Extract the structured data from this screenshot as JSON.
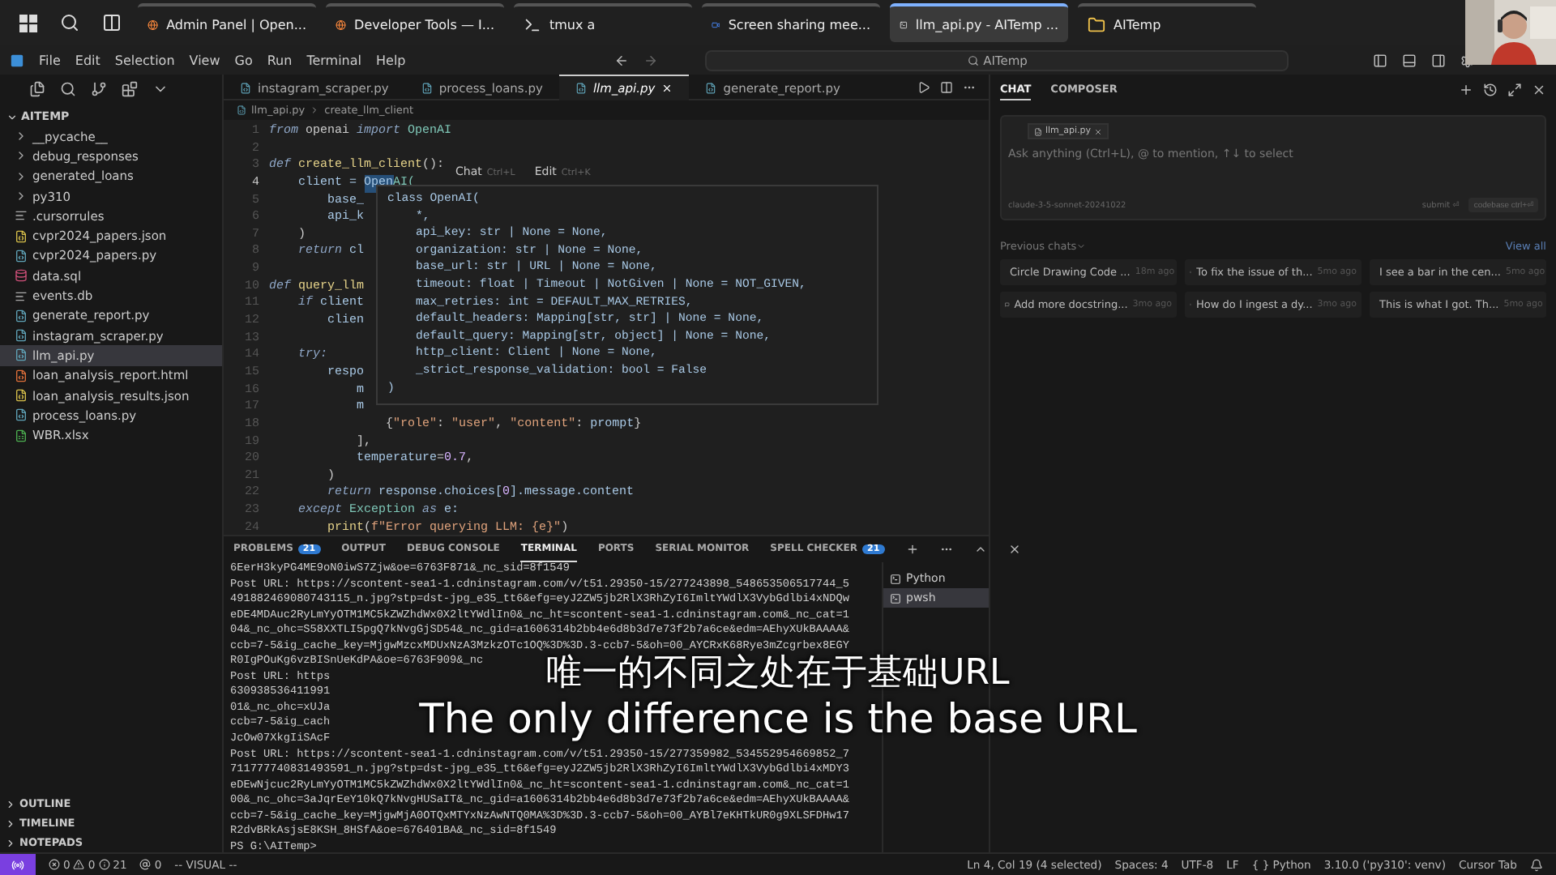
{
  "taskbar": {
    "apps": [
      {
        "label": "Admin Panel | Open...",
        "selected": false
      },
      {
        "label": "Developer Tools — I...",
        "selected": false
      },
      {
        "label": "tmux a",
        "selected": false
      },
      {
        "label": "Screen sharing mee...",
        "selected": false
      },
      {
        "label": "llm_api.py - AITemp ...",
        "selected": true
      },
      {
        "label": "AITemp",
        "selected": false
      }
    ]
  },
  "webcam": {
    "kind": "picture"
  },
  "menu": [
    "File",
    "Edit",
    "Selection",
    "View",
    "Go",
    "Run",
    "Terminal",
    "Help"
  ],
  "command_center": {
    "value": "AITemp"
  },
  "explorer": {
    "title": "AITEMP",
    "items": [
      {
        "name": "__pycache__",
        "kind": "folder",
        "selected": false
      },
      {
        "name": "debug_responses",
        "kind": "folder",
        "selected": false
      },
      {
        "name": "generated_loans",
        "kind": "folder",
        "selected": false
      },
      {
        "name": "py310",
        "kind": "folder",
        "selected": false
      },
      {
        "name": ".cursorrules",
        "kind": "text",
        "selected": false
      },
      {
        "name": "cvpr2024_papers.json",
        "kind": "json",
        "selected": false
      },
      {
        "name": "cvpr2024_papers.py",
        "kind": "py",
        "selected": false
      },
      {
        "name": "data.sql",
        "kind": "sql",
        "selected": false
      },
      {
        "name": "events.db",
        "kind": "text",
        "selected": false
      },
      {
        "name": "generate_report.py",
        "kind": "py",
        "selected": false
      },
      {
        "name": "instagram_scraper.py",
        "kind": "py",
        "selected": false
      },
      {
        "name": "llm_api.py",
        "kind": "py",
        "selected": true
      },
      {
        "name": "loan_analysis_report.html",
        "kind": "html",
        "selected": false
      },
      {
        "name": "loan_analysis_results.json",
        "kind": "json",
        "selected": false
      },
      {
        "name": "process_loans.py",
        "kind": "py",
        "selected": false
      },
      {
        "name": "WBR.xlsx",
        "kind": "xlsx",
        "selected": false
      }
    ],
    "sections": [
      "OUTLINE",
      "TIMELINE",
      "NOTEPADS"
    ]
  },
  "editor_tabs": [
    {
      "label": "instagram_scraper.py",
      "selected": false
    },
    {
      "label": "process_loans.py",
      "selected": false
    },
    {
      "label": "llm_api.py",
      "selected": true
    },
    {
      "label": "generate_report.py",
      "selected": false
    }
  ],
  "breadcrumb": [
    "llm_api.py",
    "create_llm_client"
  ],
  "inline_hint": [
    {
      "label": "Chat",
      "key": "Ctrl+L"
    },
    {
      "label": "Edit",
      "key": "Ctrl+K"
    }
  ],
  "code": [
    {
      "n": "1",
      "tokens": [
        {
          "t": "from",
          "kind": "kw"
        },
        {
          "t": " openai ",
          "kind": "plain"
        },
        {
          "t": "import",
          "kind": "kw"
        },
        {
          "t": " OpenAI",
          "kind": "cls"
        }
      ]
    },
    {
      "n": "2"
    },
    {
      "n": "3",
      "tokens": [
        {
          "t": "def ",
          "kind": "kw"
        },
        {
          "t": "create_llm_client",
          "kind": "fn"
        },
        {
          "t": "():",
          "kind": "plain"
        }
      ]
    },
    {
      "n": "4",
      "tokens": [
        {
          "t": "    client = ",
          "kind": "var"
        },
        {
          "t": "Open",
          "kind": "sel"
        },
        {
          "t": "AI(",
          "kind": "cls"
        }
      ]
    },
    {
      "n": "5",
      "tokens": [
        {
          "t": "        base_",
          "kind": "var"
        }
      ]
    },
    {
      "n": "6",
      "tokens": [
        {
          "t": "        api_k",
          "kind": "var"
        }
      ]
    },
    {
      "n": "7",
      "tokens": [
        {
          "t": "    )",
          "kind": "plain"
        }
      ]
    },
    {
      "n": "8",
      "tokens": [
        {
          "t": "    return",
          "kind": "kw"
        },
        {
          "t": " cl",
          "kind": "var"
        }
      ]
    },
    {
      "n": "9"
    },
    {
      "n": "10",
      "tokens": [
        {
          "t": "def ",
          "kind": "kw"
        },
        {
          "t": "query_llm",
          "kind": "fn"
        }
      ]
    },
    {
      "n": "11",
      "tokens": [
        {
          "t": "    if",
          "kind": "kw"
        },
        {
          "t": " client",
          "kind": "var"
        }
      ]
    },
    {
      "n": "12",
      "tokens": [
        {
          "t": "        clien",
          "kind": "var"
        }
      ]
    },
    {
      "n": "13"
    },
    {
      "n": "14",
      "tokens": [
        {
          "t": "    try:",
          "kind": "kw"
        }
      ]
    },
    {
      "n": "15",
      "tokens": [
        {
          "t": "        respo",
          "kind": "var"
        }
      ]
    },
    {
      "n": "16",
      "tokens": [
        {
          "t": "            m",
          "kind": "var"
        }
      ]
    },
    {
      "n": "17",
      "tokens": [
        {
          "t": "            m",
          "kind": "var"
        }
      ]
    },
    {
      "n": "18",
      "tokens": [
        {
          "t": "                {",
          "kind": "plain"
        },
        {
          "t": "\"role\"",
          "kind": "str"
        },
        {
          "t": ": ",
          "kind": "plain"
        },
        {
          "t": "\"user\"",
          "kind": "str"
        },
        {
          "t": ", ",
          "kind": "plain"
        },
        {
          "t": "\"content\"",
          "kind": "str"
        },
        {
          "t": ": ",
          "kind": "plain"
        },
        {
          "t": "prompt",
          "kind": "var"
        },
        {
          "t": "}",
          "kind": "plain"
        }
      ]
    },
    {
      "n": "19",
      "tokens": [
        {
          "t": "            ],",
          "kind": "plain"
        }
      ]
    },
    {
      "n": "20",
      "tokens": [
        {
          "t": "            temperature",
          "kind": "var"
        },
        {
          "t": "=",
          "kind": "plain"
        },
        {
          "t": "0.7",
          "kind": "num"
        },
        {
          "t": ",",
          "kind": "plain"
        }
      ]
    },
    {
      "n": "21",
      "tokens": [
        {
          "t": "        )",
          "kind": "plain"
        }
      ]
    },
    {
      "n": "22",
      "tokens": [
        {
          "t": "        return",
          "kind": "kw"
        },
        {
          "t": " response.choices[",
          "kind": "var"
        },
        {
          "t": "0",
          "kind": "num"
        },
        {
          "t": "].message.content",
          "kind": "var"
        }
      ]
    },
    {
      "n": "23",
      "tokens": [
        {
          "t": "    except",
          "kind": "kw"
        },
        {
          "t": " Exception ",
          "kind": "cls"
        },
        {
          "t": "as",
          "kind": "kw"
        },
        {
          "t": " e:",
          "kind": "var"
        }
      ]
    },
    {
      "n": "24",
      "tokens": [
        {
          "t": "        print",
          "kind": "fn"
        },
        {
          "t": "(",
          "kind": "plain"
        },
        {
          "t": "f\"Error querying LLM: {e}\"",
          "kind": "str"
        },
        {
          "t": ")",
          "kind": "plain"
        }
      ]
    }
  ],
  "hover": {
    "lines": [
      "class OpenAI(",
      "    *,",
      "    api_key: str | None = None,",
      "    organization: str | None = None,",
      "    base_url: str | URL | None = None,",
      "    timeout: float | Timeout | NotGiven | None = NOT_GIVEN,",
      "    max_retries: int = DEFAULT_MAX_RETRIES,",
      "    default_headers: Mapping[str, str] | None = None,",
      "    default_query: Mapping[str, object] | None = None,",
      "    http_client: Client | None = None,",
      "    _strict_response_validation: bool = False",
      ")"
    ]
  },
  "panel": {
    "tabs": [
      {
        "label": "PROBLEMS",
        "badge": "21",
        "selected": false
      },
      {
        "label": "OUTPUT",
        "selected": false
      },
      {
        "label": "DEBUG CONSOLE",
        "selected": false
      },
      {
        "label": "TERMINAL",
        "selected": true
      },
      {
        "label": "PORTS",
        "selected": false
      },
      {
        "label": "SERIAL MONITOR",
        "selected": false
      },
      {
        "label": "SPELL CHECKER",
        "badge": "21",
        "selected": false
      }
    ],
    "terminal_lines": [
      "6EerH3kyPG4ME9oN0iwS7Zjw&oe=6763F871&_nc_sid=8f1549",
      "Post URL: https://scontent-sea1-1.cdninstagram.com/v/t51.29350-15/277243898_548653506517744_5",
      "491882469080743115_n.jpg?stp=dst-jpg_e35_tt6&efg=eyJ2ZW5jb2RlX3RhZyI6ImltYWdlX3VybGdlbi4xNDQw",
      "eDE4MDAuc2RyLmYyOTM1MC5kZWZhdWx0X2ltYWdlIn0&_nc_ht=scontent-sea1-1.cdninstagram.com&_nc_cat=1",
      "04&_nc_ohc=S58XXTLI5pgQ7kNvgGjSD54&_nc_gid=a1606314b2bb4e6d8b3d7e73f2b7a6ce&edm=AEhyXUkBAAAA&",
      "ccb=7-5&ig_cache_key=MjgwMzcxMDUxNzA3MzkzOTc1OQ%3D%3D.3-ccb7-5&oh=00_AYCRxK68Rye3mZcgrbex8EGY",
      "R0IgPOuKg6vzBISnUeKdPA&oe=6763F909&_nc",
      "Post URL: https",
      "630938536411991",
      "01&_nc_ohc=xUJa",
      "ccb=7-5&ig_cach",
      "JcOw07XkgIiSAcF",
      "Post URL: https://scontent-sea1-1.cdninstagram.com/v/t51.29350-15/277359982_534552954669852_7",
      "711777740831493591_n.jpg?stp=dst-jpg_e35_tt6&efg=eyJ2ZW5jb2RlX3RhZyI6ImltYWdlX3VybGdlbi4xMDY3",
      "eDEwNjcuc2RyLmYyOTM1MC5kZWZhdWx0X2ltYWdlIn0&_nc_ht=scontent-sea1-1.cdninstagram.com&_nc_cat=1",
      "00&_nc_ohc=3aJqrEeY10kQ7kNvgHUSaIT&_nc_gid=a1606314b2bb4e6d8b3d7e73f2b7a6ce&edm=AEhyXUkBAAAA&",
      "ccb=7-5&ig_cache_key=MjgwMjA0OTQxMTYxNzAwNTQ0MA%3D%3D.3-ccb7-5&oh=00_AYBl7eKHTkUR0g9XLSFDHw17",
      "R2dvBRkAsjsE8KSH_8HSfA&oe=676401BA&_nc_sid=8f1549",
      "PS G:\\AITemp> "
    ],
    "terminals": [
      {
        "label": "Python",
        "selected": false
      },
      {
        "label": "pwsh",
        "selected": true
      }
    ]
  },
  "chat": {
    "tabs": [
      {
        "label": "CHAT",
        "selected": true
      },
      {
        "label": "COMPOSER",
        "selected": false
      }
    ],
    "context_chip": "llm_api.py",
    "input": {
      "placeholder": "Ask anything (Ctrl+L), @ to mention, ↑↓ to select"
    },
    "model": "claude-3-5-sonnet-20241022",
    "submit": "submit ⏎",
    "codebase": "codebase ctrl+⏎",
    "previous_title": "Previous chats",
    "view_all": "View all",
    "previous": [
      {
        "title": "Circle Drawing Code ...",
        "time": "18m ago"
      },
      {
        "title": "To fix the issue of th...",
        "time": "5mo ago"
      },
      {
        "title": "I see a bar in the cen...",
        "time": "5mo ago"
      },
      {
        "title": "Add more docstring...",
        "time": "3mo ago"
      },
      {
        "title": "How do I ingest a dy...",
        "time": "3mo ago"
      },
      {
        "title": "This is what I got. Th...",
        "time": "5mo ago"
      }
    ]
  },
  "subtitles": [
    "唯一的不同之处在于基础URL",
    "The only difference is the base URL"
  ],
  "status_bar": {
    "errors": "0",
    "warnings": "0",
    "infos": "21",
    "ports": "0",
    "mode": "-- VISUAL --",
    "right": [
      "Ln 4, Col 19 (4 selected)",
      "Spaces: 4",
      "UTF-8",
      "LF",
      "{ } Python",
      "3.10.0 ('py310': venv)",
      "Cursor Tab"
    ]
  }
}
